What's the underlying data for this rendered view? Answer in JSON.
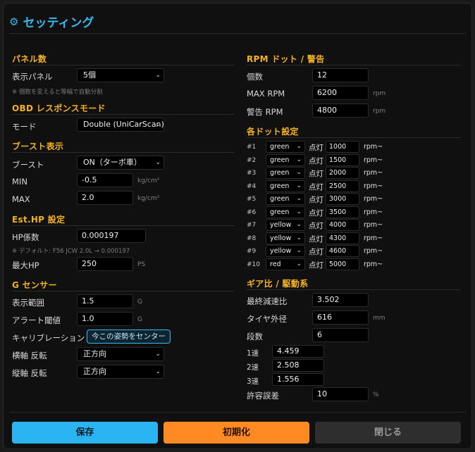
{
  "title": "セッティング",
  "panel": {
    "heading": "パネル数",
    "display_label": "表示パネル",
    "display_value": "5個",
    "note": "※ 個数を変えると等幅で自動分割"
  },
  "obd": {
    "heading": "OBD レスポンスモード",
    "mode_label": "モード",
    "mode_value": "Double (UniCarScan)"
  },
  "boost": {
    "heading": "ブースト表示",
    "boost_label": "ブースト",
    "boost_value": "ON（ターボ車）",
    "min_label": "MIN",
    "min_value": "-0.5",
    "max_label": "MAX",
    "max_value": "2.0",
    "unit": "kg/cm²"
  },
  "esthp": {
    "heading": "Est.HP 設定",
    "coef_label": "HP係数",
    "coef_value": "0.000197",
    "note": "※ デフォルト: F56 JCW 2.0L → 0.000197",
    "max_label": "最大HP",
    "max_value": "250",
    "unit": "PS"
  },
  "gsensor": {
    "heading": "G センサー",
    "range_label": "表示範囲",
    "range_value": "1.5",
    "alert_label": "アラート閾値",
    "alert_value": "1.0",
    "unit": "G",
    "cal_label": "キャリブレーション",
    "cal_button": "今この姿勢をセンター",
    "lat_label": "横軸 反転",
    "lat_value": "正方向",
    "lon_label": "縦軸 反転",
    "lon_value": "正方向"
  },
  "rpm": {
    "heading": "RPM ドット / 警告",
    "count_label": "個数",
    "count_value": "12",
    "max_label": "MAX RPM",
    "max_value": "6200",
    "warn_label": "警告 RPM",
    "warn_value": "4800",
    "unit": "rpm"
  },
  "dots": {
    "heading": "各ドット設定",
    "on_label": "点灯",
    "unit": "rpm~",
    "rows": [
      {
        "num": "#1",
        "color": "green",
        "rpm": "1000"
      },
      {
        "num": "#2",
        "color": "green",
        "rpm": "1500"
      },
      {
        "num": "#3",
        "color": "green",
        "rpm": "2000"
      },
      {
        "num": "#4",
        "color": "green",
        "rpm": "2500"
      },
      {
        "num": "#5",
        "color": "green",
        "rpm": "3000"
      },
      {
        "num": "#6",
        "color": "green",
        "rpm": "3500"
      },
      {
        "num": "#7",
        "color": "yellow",
        "rpm": "4000"
      },
      {
        "num": "#8",
        "color": "yellow",
        "rpm": "4300"
      },
      {
        "num": "#9",
        "color": "yellow",
        "rpm": "4600"
      },
      {
        "num": "#10",
        "color": "red",
        "rpm": "5000"
      }
    ]
  },
  "gear": {
    "heading": "ギア比 / 駆動系",
    "final_label": "最終減速比",
    "final_value": "3.502",
    "tire_label": "タイヤ外径",
    "tire_value": "616",
    "tire_unit": "mm",
    "stages_label": "段数",
    "stages_value": "6",
    "g1_label": "1速",
    "g1_value": "4.459",
    "g2_label": "2速",
    "g2_value": "2.508",
    "g3_label": "3速",
    "g3_value": "1.556",
    "tol_label": "許容誤差",
    "tol_value": "10",
    "tol_unit": "%"
  },
  "footer": {
    "save": "保存",
    "reset": "初期化",
    "close": "閉じる"
  },
  "colors": {
    "accent_blue": "#37b8f0",
    "section_orange": "#f5b21e",
    "reset_orange": "#ff8a23"
  }
}
